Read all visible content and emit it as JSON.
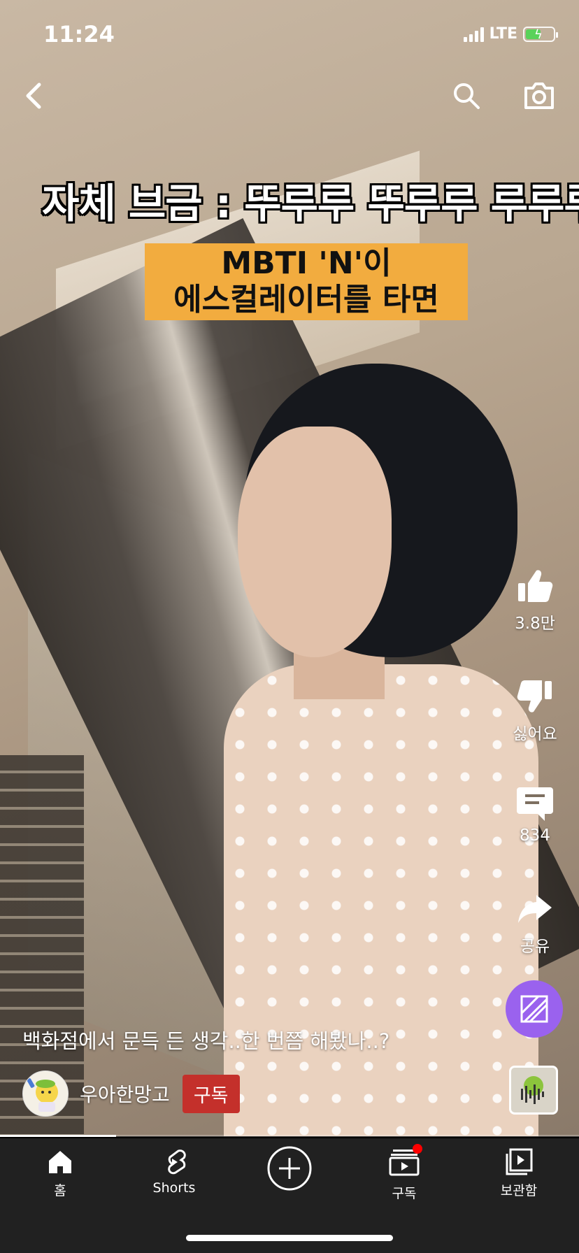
{
  "status_bar": {
    "time": "11:24",
    "network": "LTE"
  },
  "video": {
    "caption_line": "자체 브금 : 뚜루루 뚜루루 루루루",
    "caption_box_lines": [
      "MBTI 'N'이",
      "에스컬레이터를 타면"
    ],
    "progress": 0.2
  },
  "top_bar": {
    "back_icon": "chevron-left-icon",
    "search_icon": "search-icon",
    "camera_icon": "camera-icon"
  },
  "actions": {
    "like": {
      "icon": "thumbs-up-icon",
      "label": "3.8만"
    },
    "dislike": {
      "icon": "thumbs-down-icon",
      "label": "싫어요"
    },
    "comment": {
      "icon": "comment-icon",
      "label": "834"
    },
    "share": {
      "icon": "share-icon",
      "label": "공유"
    },
    "remix": {
      "icon": "remix-icon",
      "color": "#9a62ee"
    }
  },
  "description": "백화점에서 문득 든 생각..한 번쯤 해봤나..?",
  "channel": {
    "name": "우아한망고",
    "subscribe_label": "구독",
    "subscribe_color": "#c4302b"
  },
  "bottom_nav": [
    {
      "label": "홈",
      "icon": "home-icon"
    },
    {
      "label": "Shorts",
      "icon": "shorts-icon"
    },
    {
      "label": "",
      "icon": "create-plus-icon"
    },
    {
      "label": "구독",
      "icon": "subscriptions-icon",
      "badge_color": "#ff0000"
    },
    {
      "label": "보관함",
      "icon": "library-icon"
    }
  ]
}
